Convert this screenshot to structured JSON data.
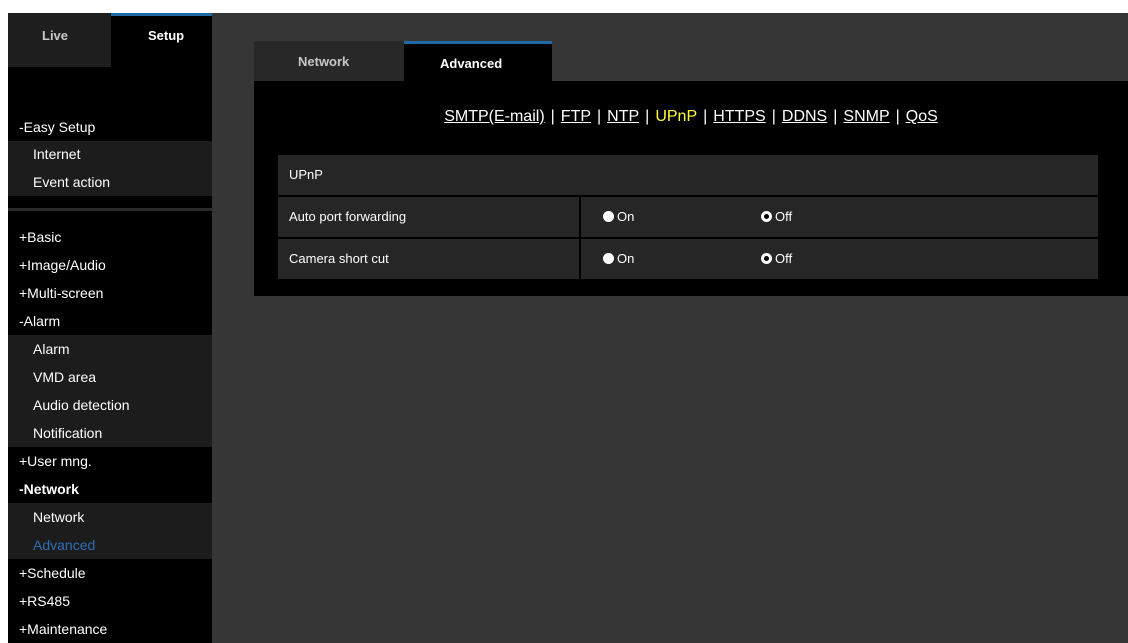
{
  "sidebar": {
    "tabs": {
      "live": "Live",
      "setup": "Setup"
    },
    "items": [
      {
        "label": "-Easy Setup"
      },
      {
        "label": "Internet"
      },
      {
        "label": "Event action"
      },
      {
        "label": "+Basic"
      },
      {
        "label": "+Image/Audio"
      },
      {
        "label": "+Multi-screen"
      },
      {
        "label": "-Alarm"
      },
      {
        "label": "Alarm"
      },
      {
        "label": "VMD area"
      },
      {
        "label": "Audio detection"
      },
      {
        "label": "Notification"
      },
      {
        "label": "+User mng."
      },
      {
        "label": "-Network"
      },
      {
        "label": "Network"
      },
      {
        "label": "Advanced"
      },
      {
        "label": "+Schedule"
      },
      {
        "label": "+RS485"
      },
      {
        "label": "+Maintenance"
      }
    ],
    "active_item": "Advanced"
  },
  "content": {
    "tabs": {
      "network": "Network",
      "advanced": "Advanced"
    },
    "subnav": {
      "links": [
        "SMTP(E-mail)",
        "FTP",
        "NTP",
        "UPnP",
        "HTTPS",
        "DDNS",
        "SNMP",
        "QoS"
      ],
      "separator": "|",
      "current": "UPnP"
    },
    "section_title": "UPnP",
    "settings": [
      {
        "label": "Auto port forwarding",
        "on": "On",
        "off": "Off",
        "value": "Off"
      },
      {
        "label": "Camera short cut",
        "on": "On",
        "off": "Off",
        "value": "Off"
      }
    ]
  },
  "colors": {
    "accent": "#1e6aa8",
    "active_link": "#ffff33",
    "active_nav": "#2e6eb5",
    "panel_bg": "#363636"
  }
}
